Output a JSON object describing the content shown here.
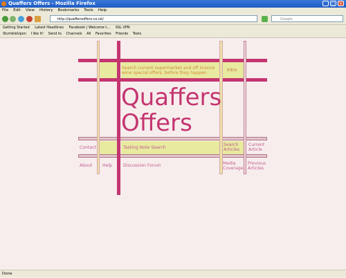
{
  "browser": {
    "window_title": "Quaffers Offers - Mozilla Firefox",
    "menu": [
      "File",
      "Edit",
      "View",
      "History",
      "Bookmarks",
      "Tools",
      "Help"
    ],
    "url": "http://quaffersoffers.co.uk/",
    "search_placeholder": "Google",
    "bookmarks": [
      "Getting Started",
      "Latest Headlines",
      "Facebook | Welcome t...",
      "SSL VPN"
    ],
    "toolbar": [
      "StumbleUpon",
      "I like it!",
      "Send to",
      "Channels",
      "All",
      "Favorites",
      "Friends",
      "Tools"
    ],
    "status": "Done"
  },
  "page": {
    "tagline": "Search current supermarket and off licence wine special offers, before they happen",
    "title_line1": "Quaffers",
    "title_line2": "Offers",
    "nav": {
      "intro": "Intro",
      "contact": "Contact",
      "tasting_note_search": "Tasting Note Search",
      "search_articles": "Search Articles",
      "current_article": "Current Article",
      "about": "About",
      "help": "Help",
      "discussion_forum": "Discussion Forum",
      "media_coverage": "Media Coverage",
      "previous_articles": "Previous Articles"
    }
  }
}
